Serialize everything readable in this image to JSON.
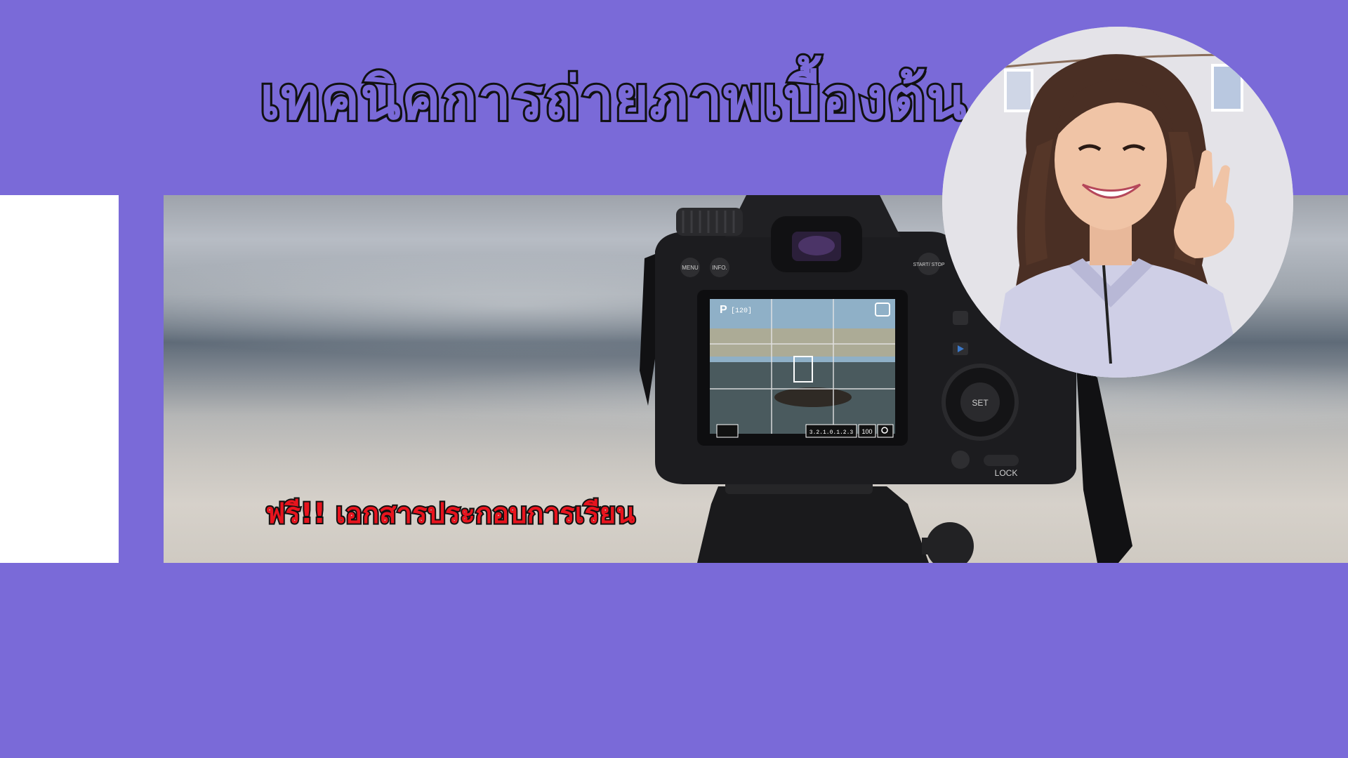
{
  "banner": {
    "title": "เทคนิคการถ่ายภาพเบื้องต้น",
    "subtitle": "ฟรี!! เอกสารประกอบการเรียน",
    "camera_labels": {
      "menu": "MENU",
      "info": "INFO.",
      "start_stop": "START/ STOP",
      "mode": "P",
      "shots": "[120]",
      "set": "SET",
      "lock": "LOCK",
      "iso": "100",
      "meter": "3.2.1.0.1.2.3"
    }
  },
  "colors": {
    "background": "#7a6ad8",
    "title_fill": "#7a6ad8",
    "title_outline": "#111111",
    "subtitle_fill": "#e8141e",
    "white_strip": "#ffffff"
  }
}
